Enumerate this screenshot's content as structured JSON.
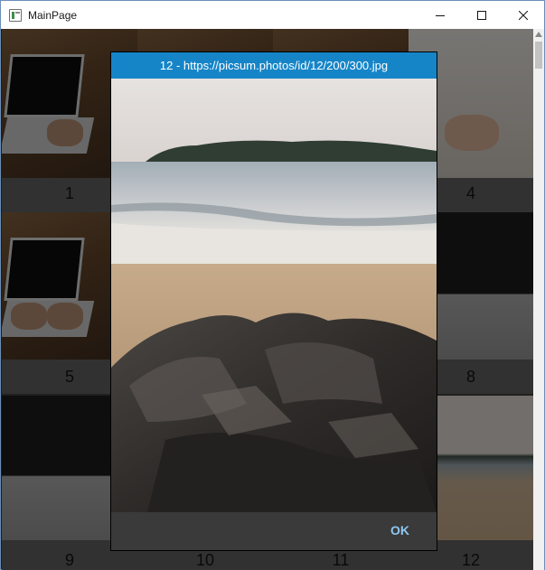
{
  "window": {
    "title": "MainPage",
    "controls": [
      "minimize-icon",
      "maximize-icon",
      "close-icon"
    ]
  },
  "grid": {
    "tiles": [
      {
        "number": "1",
        "image": "laptop-keyboard"
      },
      {
        "number": "4",
        "image": "laptop-keyboard"
      },
      {
        "number": "5",
        "image": "laptop-keyboard"
      },
      {
        "number": "8",
        "image": "laptop"
      },
      {
        "number": "9",
        "image": "laptop"
      },
      {
        "number": "10",
        "image": "laptop"
      },
      {
        "number": "11",
        "image": "laptop"
      },
      {
        "number": "12",
        "image": "beach"
      }
    ]
  },
  "dialog": {
    "title": "12 - https://picsum.photos/id/12/200/300.jpg",
    "ok_label": "OK",
    "image": "beach-rocks-photo"
  },
  "colors": {
    "dialog_header": "#1685c8",
    "ok_text": "#8fc7f0",
    "overlay": "#3b3b3b"
  }
}
